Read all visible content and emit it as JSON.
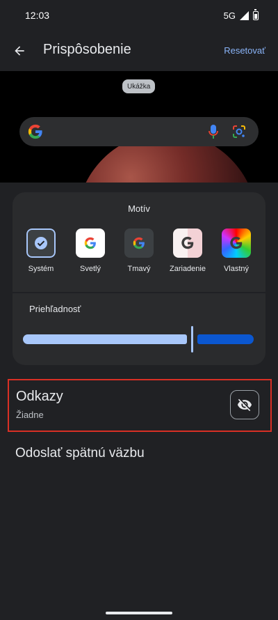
{
  "status_bar": {
    "time": "12:03",
    "network": "5G"
  },
  "app_bar": {
    "title": "Prispôsobenie",
    "reset_label": "Resetovať"
  },
  "preview": {
    "badge": "Ukážka"
  },
  "theme_card": {
    "title": "Motív",
    "themes": [
      {
        "label": "Systém",
        "selected": true
      },
      {
        "label": "Svetlý"
      },
      {
        "label": "Tmavý"
      },
      {
        "label": "Zariadenie"
      },
      {
        "label": "Vlastný"
      }
    ],
    "opacity_label": "Priehľadnosť",
    "opacity_value": 0.73
  },
  "shortcuts": {
    "title": "Odkazy",
    "subtitle": "Žiadne"
  },
  "feedback": {
    "label": "Odoslať spätnú väzbu"
  },
  "colors": {
    "accent": "#a8c7fa",
    "accent_dark": "#0b57d0",
    "background": "#202124",
    "highlight": "#d93025"
  },
  "icons": {
    "back": "arrow-back-icon",
    "mic": "mic-icon",
    "lens": "google-lens-icon",
    "check": "check-icon",
    "visibility_off": "visibility-off-icon"
  }
}
